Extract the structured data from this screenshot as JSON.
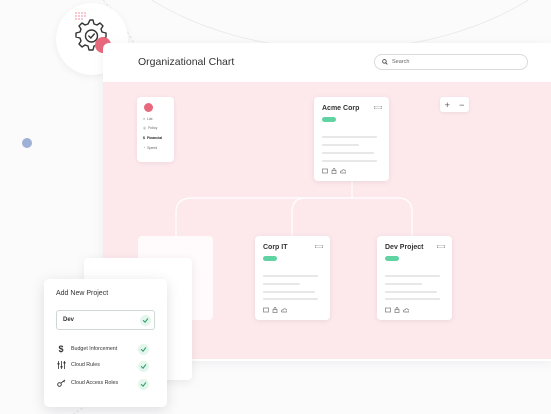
{
  "app": {
    "title": "Organizational Chart"
  },
  "search": {
    "placeholder": "Search"
  },
  "sidenav": {
    "items": [
      {
        "label": "List",
        "icon": "list-icon"
      },
      {
        "label": "Policy",
        "icon": "policy-icon"
      },
      {
        "label": "Financial",
        "icon": "dollar-icon"
      },
      {
        "label": "Speed",
        "icon": "speed-icon"
      }
    ]
  },
  "zoom": {
    "in_label": "+",
    "out_label": "−"
  },
  "org": {
    "root": {
      "name": "Acme Corp"
    },
    "children": [
      {
        "name": "Corp IT"
      },
      {
        "name": "Dev Project"
      }
    ]
  },
  "panel": {
    "title": "Add New Project",
    "field_value": "Dev",
    "options": [
      {
        "label": "Budget Inforcement",
        "icon": "dollar-icon"
      },
      {
        "label": "Cloud Rules",
        "icon": "sliders-icon"
      },
      {
        "label": "Cloud Access Roles",
        "icon": "key-icon"
      }
    ]
  },
  "colors": {
    "accent_pink": "#e8697d",
    "tag_green": "#5fd3a2",
    "canvas_bg": "#fde9ec"
  }
}
